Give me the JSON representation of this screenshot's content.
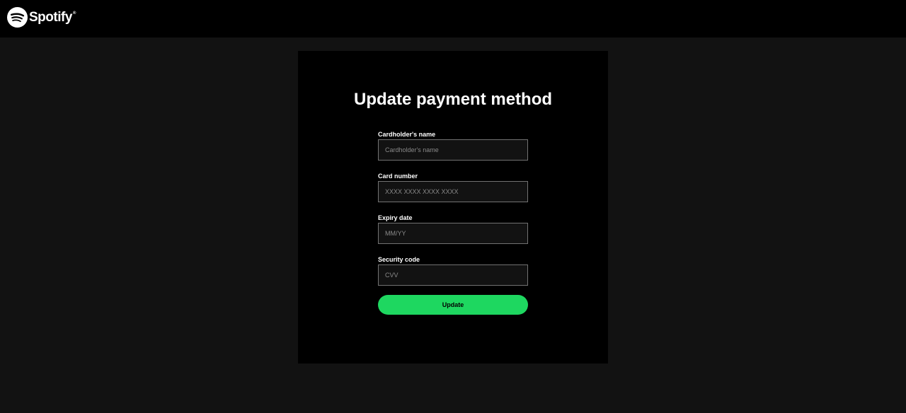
{
  "brand": {
    "name": "Spotify",
    "trademark": "®",
    "logo_icon": "spotify-logo-icon",
    "accent_color": "#1ed760"
  },
  "form": {
    "title": "Update payment method",
    "fields": [
      {
        "label": "Cardholder's name",
        "placeholder": "Cardholder's name",
        "value": ""
      },
      {
        "label": "Card number",
        "placeholder": "XXXX XXXX XXXX XXXX",
        "value": ""
      },
      {
        "label": "Expiry date",
        "placeholder": "MM/YY",
        "value": ""
      },
      {
        "label": "Security code",
        "placeholder": "CVV",
        "value": ""
      }
    ],
    "submit_label": "Update"
  }
}
